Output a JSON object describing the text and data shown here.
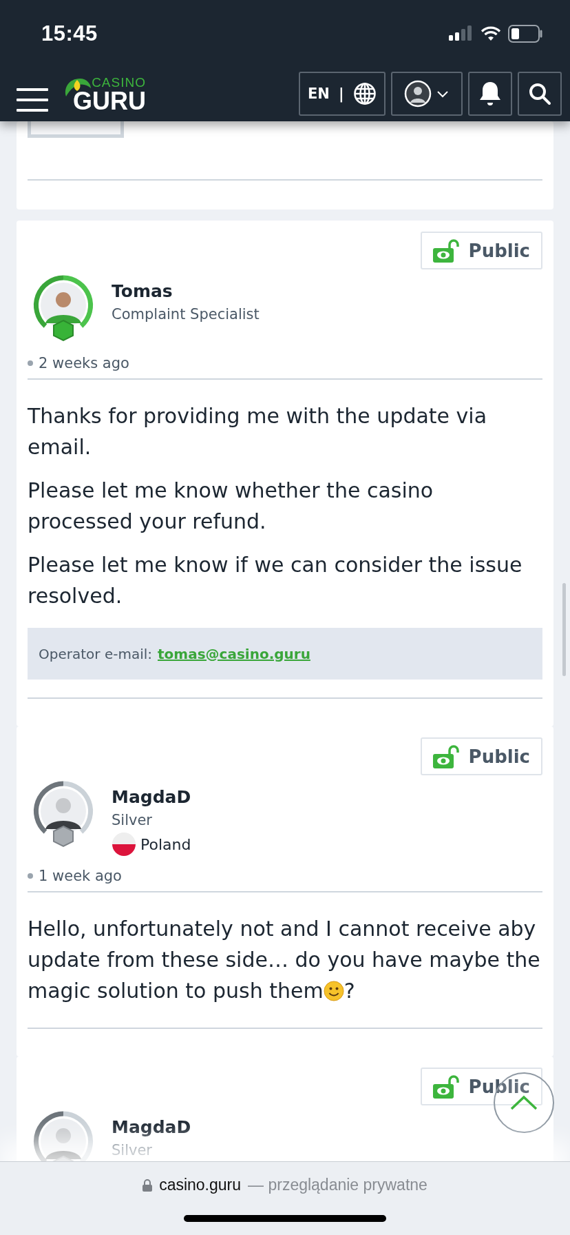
{
  "status_bar": {
    "time": "15:45"
  },
  "header": {
    "logo_top": "CASINO",
    "logo_bottom": "GURU",
    "language": "EN",
    "separator": "|"
  },
  "posts": [
    {
      "kind": "specialist",
      "author": "Tomas",
      "role": "Complaint Specialist",
      "visibility": "Public",
      "time": "2 weeks ago",
      "paragraphs": [
        "Thanks for providing me with the update via email.",
        "Please let me know whether the casino processed your refund.",
        "Please let me know if we can consider the issue resolved."
      ],
      "operator_email": {
        "label": "Operator e-mail:",
        "email": "tomas@casino.guru"
      }
    },
    {
      "kind": "member",
      "author": "MagdaD",
      "role": "Silver",
      "country": "Poland",
      "visibility": "Public",
      "time": "1 week ago",
      "paragraphs": [
        "Hello, unfortunately not and I cannot receive aby update from these side… do you have maybe the magic solution to push them"
      ],
      "trailing_emoji": true,
      "trailing_text": "?"
    },
    {
      "kind": "member",
      "author": "MagdaD",
      "role": "Silver",
      "visibility": "Public"
    }
  ],
  "browser_bar": {
    "domain": "casino.guru",
    "suffix": "— przeglądanie prywatne"
  }
}
